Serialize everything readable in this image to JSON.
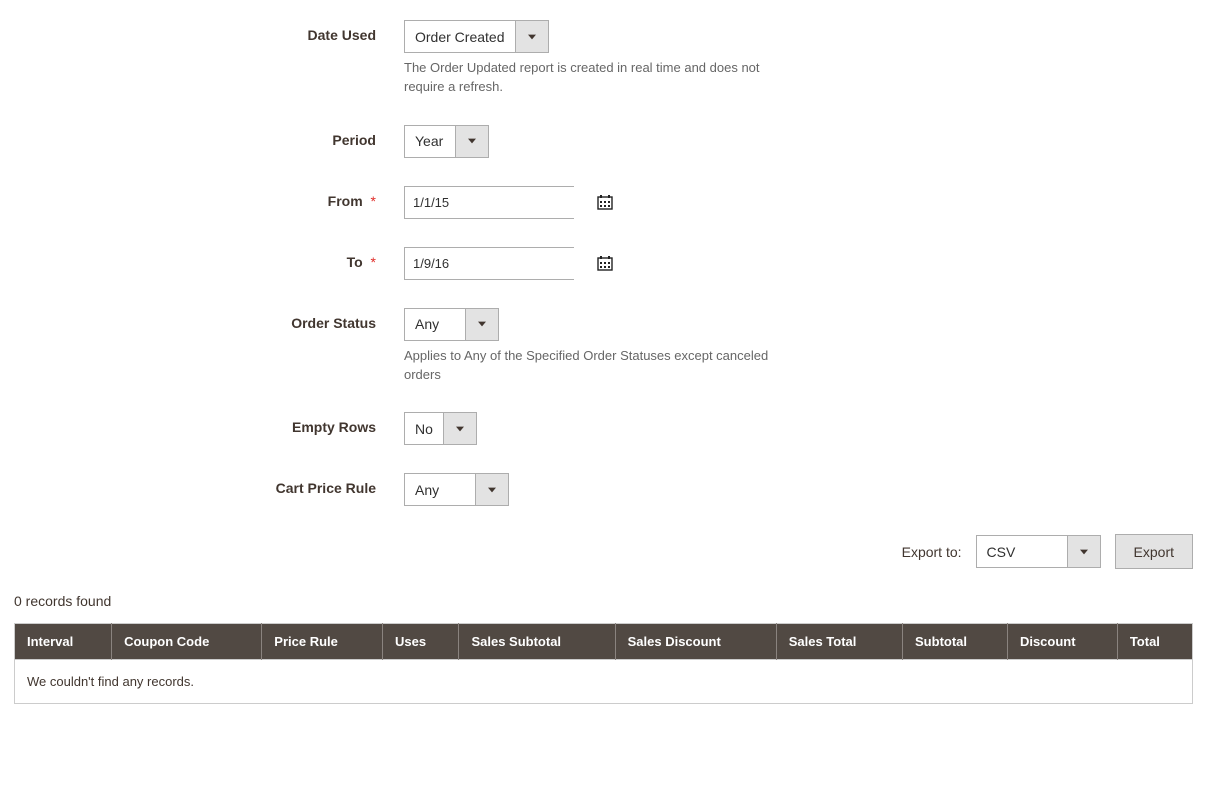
{
  "form": {
    "date_used": {
      "label": "Date Used",
      "value": "Order Created",
      "hint": "The Order Updated report is created in real time and does not require a refresh."
    },
    "period": {
      "label": "Period",
      "value": "Year"
    },
    "from": {
      "label": "From",
      "value": "1/1/15",
      "required_mark": "*"
    },
    "to": {
      "label": "To",
      "value": "1/9/16",
      "required_mark": "*"
    },
    "order_status": {
      "label": "Order Status",
      "value": "Any",
      "hint": "Applies to Any of the Specified Order Statuses except canceled orders"
    },
    "empty_rows": {
      "label": "Empty Rows",
      "value": "No"
    },
    "cart_price_rule": {
      "label": "Cart Price Rule",
      "value": "Any"
    }
  },
  "export": {
    "label": "Export to:",
    "format": "CSV",
    "button": "Export"
  },
  "records": {
    "count_text": "0 records found",
    "empty_message": "We couldn't find any records."
  },
  "table": {
    "headers": {
      "interval": "Interval",
      "coupon_code": "Coupon Code",
      "price_rule": "Price Rule",
      "uses": "Uses",
      "sales_subtotal": "Sales Subtotal",
      "sales_discount": "Sales Discount",
      "sales_total": "Sales Total",
      "subtotal": "Subtotal",
      "discount": "Discount",
      "total": "Total"
    }
  }
}
